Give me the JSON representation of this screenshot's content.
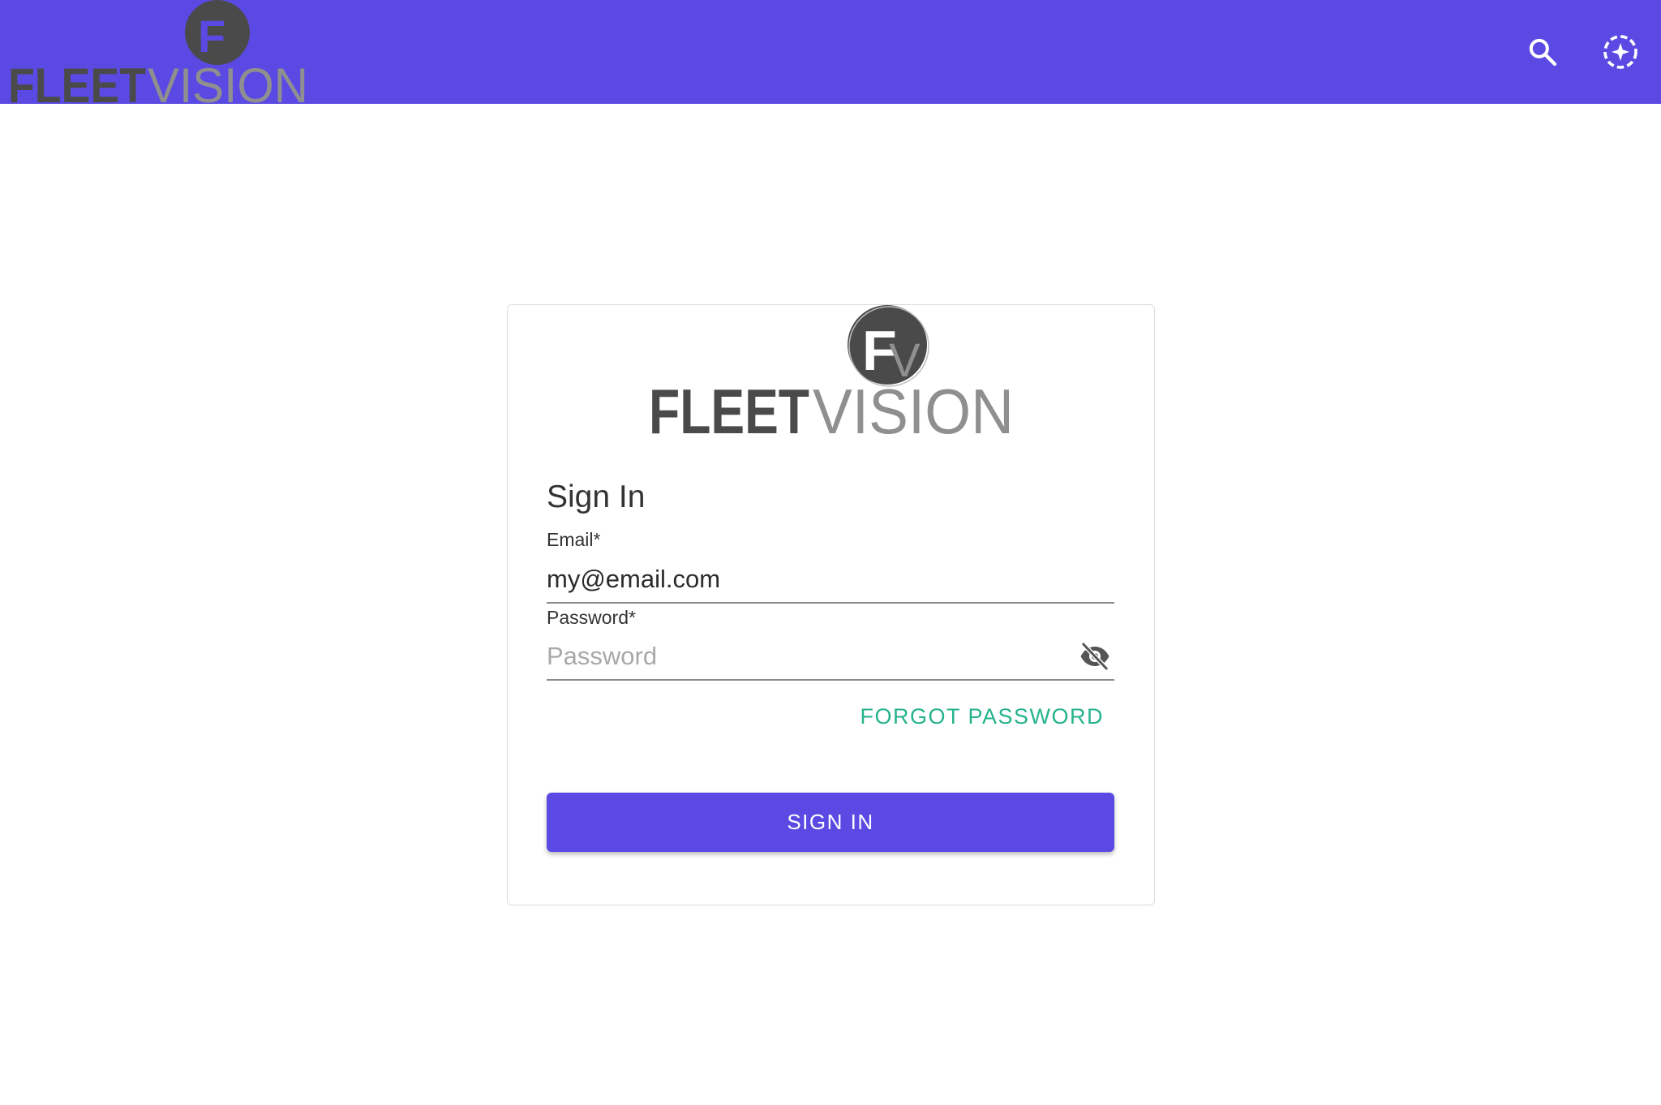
{
  "app": {
    "name": "FLEETVISION",
    "logo_word_dark": "FLEET",
    "logo_word_light": "VISION",
    "logo_monogram": "FV"
  },
  "header": {
    "background": "#5a4ae3",
    "search_icon": "search-icon",
    "assistant_icon": "sparkle-refresh-icon"
  },
  "login": {
    "title": "Sign In",
    "email_label": "Email*",
    "email_value": "my@email.com",
    "password_label": "Password*",
    "password_placeholder": "Password",
    "password_toggle_icon": "eye-off-icon",
    "forgot_password": "FORGOT PASSWORD",
    "submit_label": "SIGN IN"
  },
  "colors": {
    "accent": "#5a4ae3",
    "link": "#25b38c",
    "logo_dark": "#4a4a4a",
    "logo_light": "#8f8f8f"
  }
}
